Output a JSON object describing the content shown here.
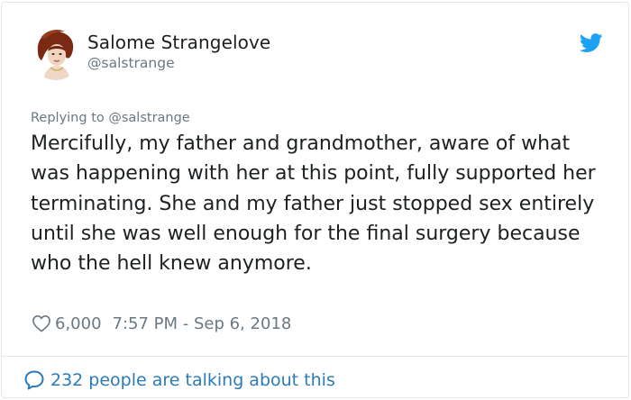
{
  "author": {
    "name": "Salome Strangelove",
    "handle": "@salstrange",
    "avatar_icon": "user-avatar"
  },
  "tweet": {
    "replying_to": "Replying to @salstrange",
    "text": "Mercifully, my father and grandmother, aware of what was happening with her at this point, fully supported her terminating. She and my father just stopped sex entirely until she was well enough for the final surgery because who the hell knew anymore.",
    "likes": "6,000",
    "timestamp": "7:57 PM - Sep 6, 2018"
  },
  "footer": {
    "conversation_label": "232 people are talking about this"
  },
  "colors": {
    "brand": "#1da1f2",
    "link": "#2b7bb9",
    "muted": "#697882"
  },
  "icons": {
    "logo": "twitter-bird-icon",
    "like": "heart-icon",
    "reply": "speech-bubble-icon"
  }
}
